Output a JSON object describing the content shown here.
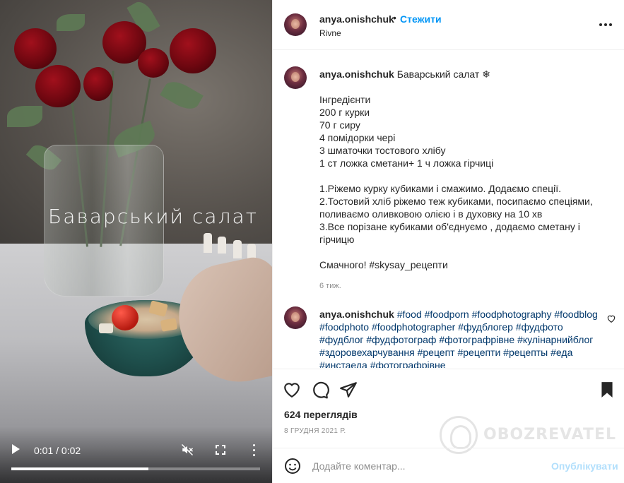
{
  "video": {
    "overlay_title": "Баварський салат",
    "time": "0:01 / 0:02",
    "progress": 0.55
  },
  "header": {
    "username": "anya.onishchuk",
    "separator": "•",
    "follow_label": "Стежити",
    "location": "Rivne"
  },
  "caption": {
    "username": "anya.onishchuk",
    "title": "Баварський салат ❄",
    "lines": [
      "",
      "Інгредієнти",
      "200 г курки",
      "70 г сиру",
      "4 помідорки чері",
      "3 шматочки тостового хлібу",
      "1 ст ложка сметани+ 1 ч ложка гірчиці",
      "",
      "1.Ріжемо курку кубиками і смажимо. Додаємо спеції.",
      "2.Тостовий хліб ріжемо теж кубиками, посипаємо спеціями, поливаємо оливковою олією і в духовку на 10 хв",
      "3.Все порізане кубиками об'єднуємо , додаємо сметану і гірчицю",
      "",
      "Смачного! #skysay_рецепти"
    ],
    "age": "6 тиж."
  },
  "comment": {
    "username": "anya.onishchuk",
    "text": "#food #foodporn #foodphotography #foodblog #foodphoto #foodphotographer #фудблогер #фудфото #фудблог #фудфотограф #фотографрівне #кулінарнийблог #здоровехарчування #рецепт #рецепти #рецепты #еда #инстаеда #фотографрівне"
  },
  "stats": {
    "views": "624 переглядів",
    "date": "8 ГРУДНЯ 2021 Р."
  },
  "watermark": "OBOZREVATEL",
  "composer": {
    "placeholder": "Додайте коментар...",
    "publish_label": "Опублікувати"
  },
  "colors": {
    "link_blue": "#0095f6",
    "hashtag": "#00376b",
    "muted": "#8e8e8e"
  }
}
